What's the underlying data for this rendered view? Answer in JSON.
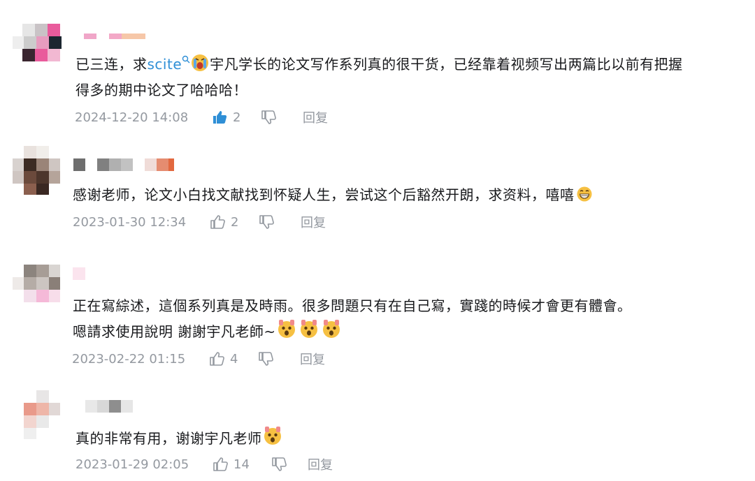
{
  "colors": {
    "text": "#18191c",
    "meta": "#9499a0",
    "link": "#2f8fd6",
    "liked": "#2f8fd6"
  },
  "comments": [
    {
      "line1_a": "已三连，求",
      "line1_link": "scite",
      "line1_b": "宇凡学长的论文写作系列真的很干货，已经靠着视频写出两篇比以前有把握",
      "line2": "得多的期中论文了哈哈哈！",
      "time": "2024-12-20 14:08",
      "likes": "2",
      "liked": true,
      "reply": "回复",
      "icons": [
        "search-icon",
        "crying-face-icon",
        "thumbs-up-icon",
        "thumbs-down-icon"
      ]
    },
    {
      "line1": "感谢老师，论文小白找文献找到怀疑人生，尝试这个后豁然开朗，求资料，嘻嘻",
      "time": "2023-01-30 12:34",
      "likes": "2",
      "liked": false,
      "reply": "回复",
      "icons": [
        "grinning-face-icon",
        "thumbs-up-icon",
        "thumbs-down-icon"
      ]
    },
    {
      "line1": "正在寫綜述，這個系列真是及時雨。很多問題只有在自己寫，實踐的時候才會更有體會。",
      "line2": "嗯請求使用說明 謝謝宇凡老師~",
      "time": "2023-02-22 01:15",
      "likes": "4",
      "liked": false,
      "reply": "回复",
      "icons": [
        "shocked-face-icon",
        "thumbs-up-icon",
        "thumbs-down-icon"
      ]
    },
    {
      "line1": "真的非常有用，谢谢宇凡老师",
      "time": "2023-01-29 02:05",
      "likes": "14",
      "liked": false,
      "reply": "回复",
      "icons": [
        "shocked-face-icon",
        "thumbs-up-icon",
        "thumbs-down-icon"
      ]
    }
  ]
}
